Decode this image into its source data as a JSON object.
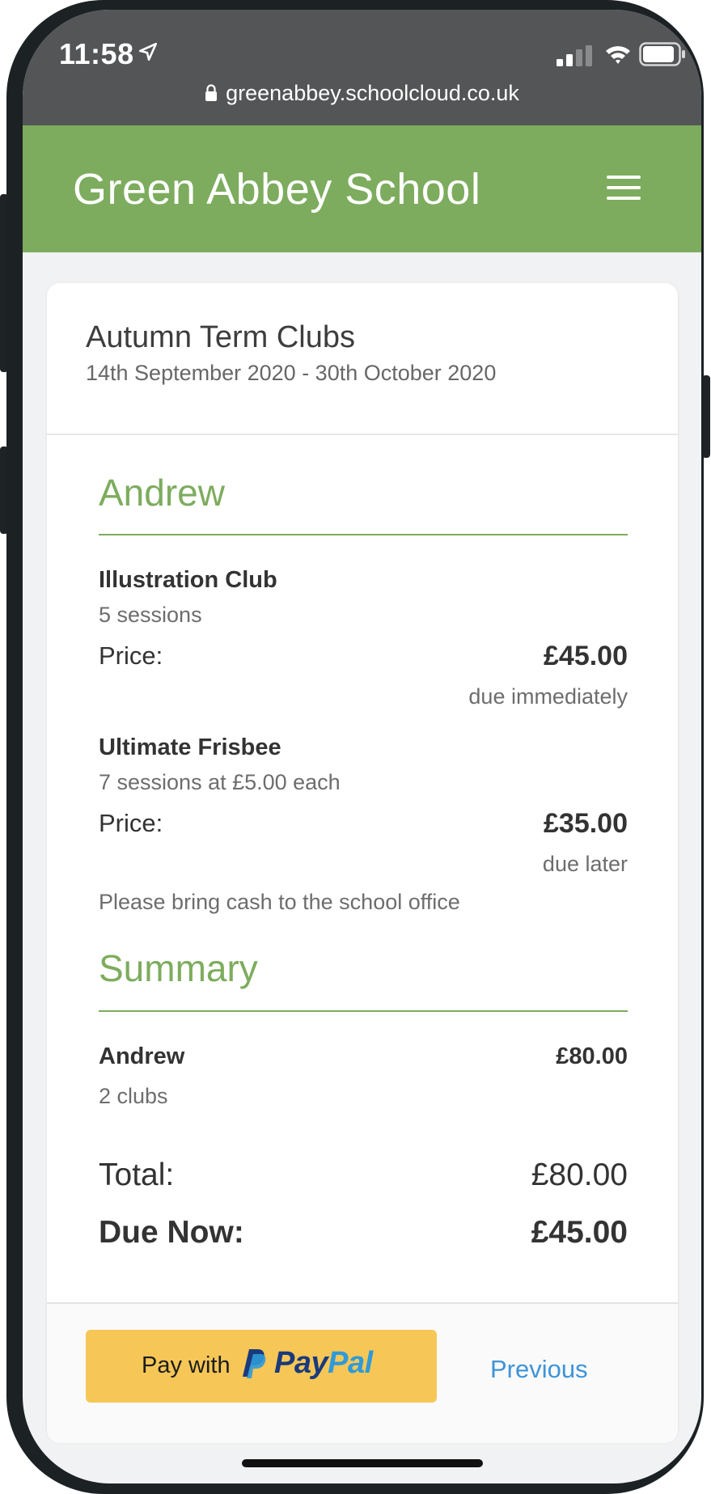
{
  "status_bar": {
    "time": "11:58",
    "url": "greenabbey.schoolcloud.co.uk",
    "icons": [
      "location-arrow-icon",
      "cell-signal-icon",
      "wifi-icon",
      "battery-icon",
      "lock-icon"
    ]
  },
  "header": {
    "school_name": "Green Abbey School",
    "menu_icon": "hamburger-menu-icon",
    "color": "#7dac5e"
  },
  "event": {
    "title": "Autumn Term Clubs",
    "dates": "14th September 2020 - 30th October 2020"
  },
  "student": {
    "name": "Andrew",
    "clubs": [
      {
        "name": "Illustration Club",
        "sessions": "5 sessions",
        "price_label": "Price:",
        "price": "£45.00",
        "due": "due immediately"
      },
      {
        "name": "Ultimate Frisbee",
        "sessions": "7 sessions at £5.00 each",
        "price_label": "Price:",
        "price": "£35.00",
        "due": "due later",
        "note": "Please bring cash to the school office"
      }
    ]
  },
  "summary": {
    "title": "Summary",
    "student_name": "Andrew",
    "student_amount": "£80.00",
    "club_count": "2 clubs",
    "total_label": "Total:",
    "total_value": "£80.00",
    "due_now_label": "Due Now:",
    "due_now_value": "£45.00"
  },
  "footer": {
    "pay_with": "Pay with",
    "paypal_pay": "Pay",
    "paypal_pal": "Pal",
    "previous": "Previous",
    "paypal_button_color": "#f6c757",
    "link_color": "#3e94d8"
  }
}
